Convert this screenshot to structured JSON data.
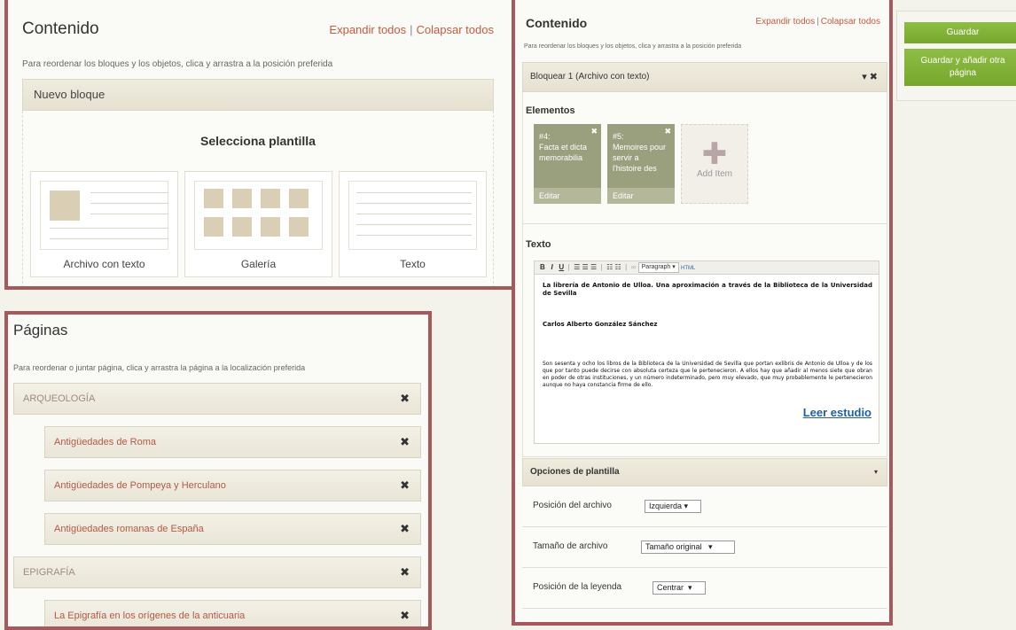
{
  "content_panel": {
    "title": "Contenido",
    "expand_all": "Expandir todos",
    "separator": "|",
    "collapse_all": "Colapsar todos",
    "instructions": "Para reordenar los bloques y los objetos, clica y arrastra a la posición preferida",
    "new_block": "Nuevo bloque",
    "select_template": "Selecciona plantilla",
    "templates": [
      "Archivo con texto",
      "Galería",
      "Texto"
    ]
  },
  "pages_panel": {
    "title": "Páginas",
    "instructions": "Para reordenar o juntar página, clica y arrastra la página a la localización preferida",
    "close_glyph": "✖",
    "pages": [
      {
        "label": "ARQUEOLOGÍA",
        "level": 0
      },
      {
        "label": "Antigüedades de Roma",
        "level": 1
      },
      {
        "label": "Antigüedades de Pompeya y Herculano",
        "level": 1
      },
      {
        "label": "Antigüedades romanas de España",
        "level": 1
      },
      {
        "label": "EPIGRAFÍA",
        "level": 0
      },
      {
        "label": "La Epigrafía en los orígenes de la anticuaria",
        "level": 1
      }
    ]
  },
  "editor_panel": {
    "title": "Contenido",
    "expand_all": "Expandir todos",
    "separator": "|",
    "collapse_all": "Colapsar todos",
    "instructions": "Para reordenar los bloques y los objetos, clica y arrastra a la posición preferida",
    "block_title": "Bloquear 1 (Archivo con texto)",
    "block_controls": "▾ ✖",
    "elements_heading": "Elementos",
    "items": [
      {
        "num": "#4:",
        "title": "Facta et dicta memorabilia",
        "edit": "Editar",
        "close": "✖"
      },
      {
        "num": "#5:",
        "title": "Memoires pour servir a l'histoire des",
        "edit": "Editar",
        "close": "✖"
      }
    ],
    "add_item": "Add Item",
    "add_plus": "✚",
    "text_heading": "Texto",
    "toolbar": {
      "bold": "B",
      "italic": "I",
      "underline": "U",
      "format": "Paragraph",
      "html": "HTML"
    },
    "content": {
      "heading": "La librería de Antonio de Ulloa. Una aproximación a través de la Biblioteca de la Universidad de Sevilla",
      "author": "Carlos Alberto González Sánchez",
      "paragraph": "Son sesenta y ocho los libros de la Biblioteca de la Universidad de Sevilla que portan exlibris de Antonio de Ulloa y de los que por tanto puede decirse con absoluta certeza que le pertenecieron. A ellos hay que añadir al menos siete que obran en poder de otras instituciones, y un número indeterminado, pero muy elevado, que muy probablemente le pertenecieron aunque no haya constancia firme de ello.",
      "link": "Leer estudio"
    },
    "template_options": {
      "title": "Opciones de plantilla",
      "caret": "▾",
      "rows": [
        {
          "label": "Posición del archivo",
          "value": "Izquierda"
        },
        {
          "label": "Tamaño de archivo",
          "value": "Tamaño original"
        },
        {
          "label": "Posición de la leyenda",
          "value": "Centrar"
        }
      ]
    }
  },
  "actions": {
    "save": "Guardar",
    "save_add": "Guardar y añadir otra página"
  },
  "colors": {
    "frame": "#a6585b",
    "link": "#c55a40",
    "button": "#7fb035"
  }
}
